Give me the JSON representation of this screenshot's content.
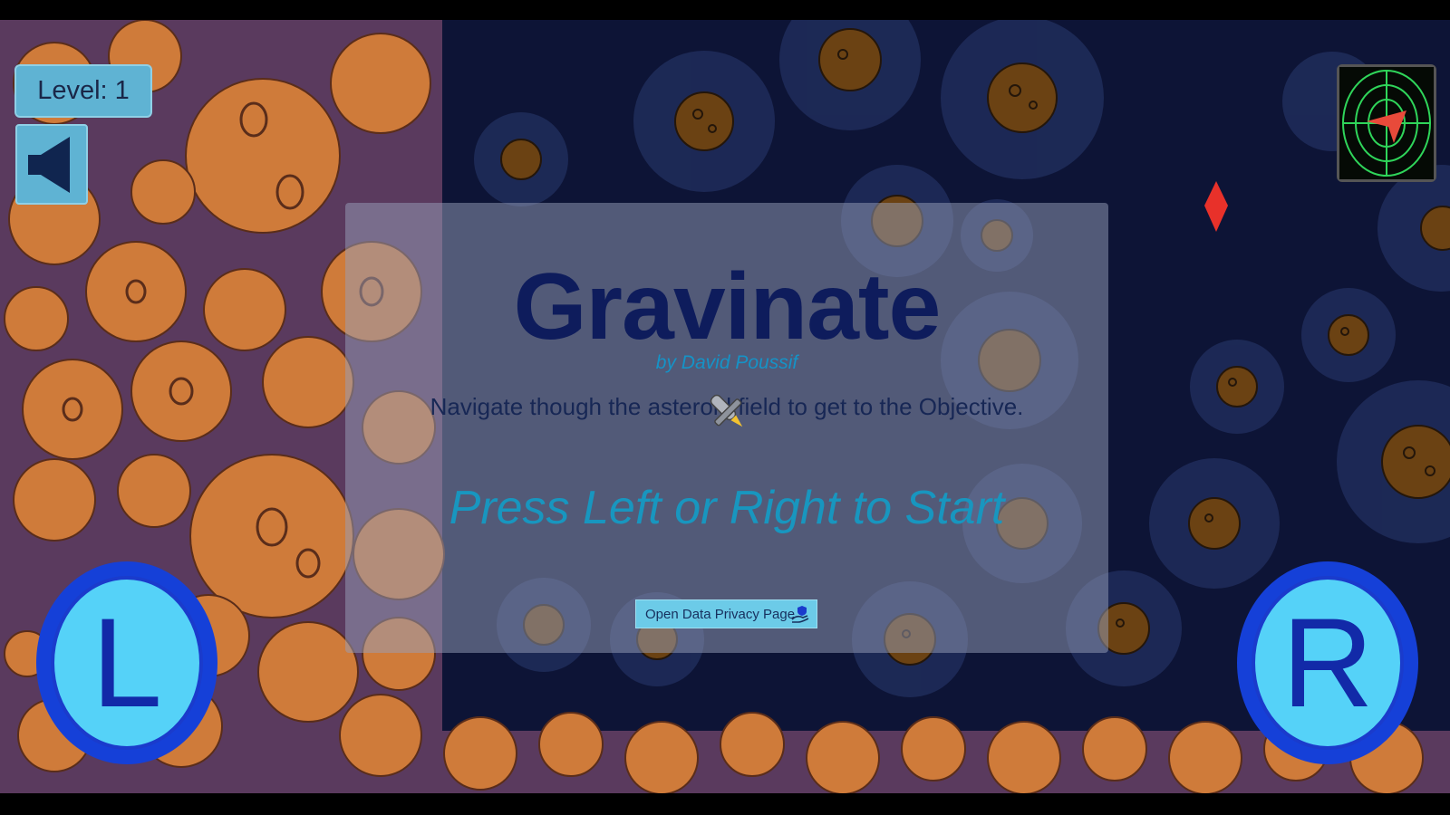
{
  "hud": {
    "level_text": "Level: 1",
    "sound_icon": "speaker-icon",
    "radar_icon": "radar-icon"
  },
  "title_panel": {
    "title": "Gravinate",
    "author": "by David Poussif",
    "instructions": "Navigate though the asteroid field to get to the Objective.",
    "prompt": "Press Left or Right to Start",
    "privacy_button": "Open Data Privacy Page",
    "privacy_icon": "privacy-hand-icon"
  },
  "controls": {
    "left_label": "L",
    "right_label": "R"
  },
  "colors": {
    "space": "#0d1436",
    "wall": "#5a3a5e",
    "wall_asteroid": "#cf7b3a",
    "asteroid": "#6b4213",
    "title": "#0e1c5c",
    "accent": "#1896bf",
    "button": "#5fb3d3",
    "control_ring": "#1540d8",
    "control_fill": "#55d2f8",
    "objective_marker": "#e8312a"
  }
}
